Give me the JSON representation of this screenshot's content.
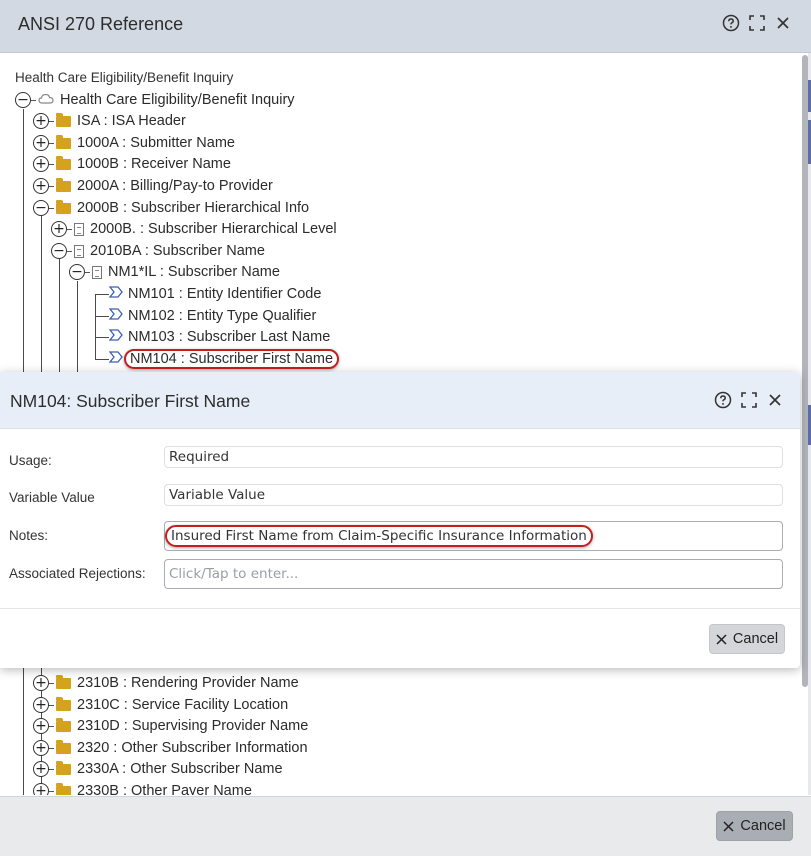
{
  "window": {
    "title": "ANSI 270 Reference",
    "help_icon": "help-circle-icon",
    "maximize_icon": "maximize-icon",
    "close_icon": "close-icon"
  },
  "tree": {
    "caption": "Health Care Eligibility/Benefit Inquiry",
    "nodes": [
      {
        "label": "Health Care Eligibility/Benefit Inquiry",
        "state": "expanded",
        "icon": "cloud-icon"
      },
      {
        "label": "ISA : ISA Header",
        "state": "collapsed",
        "icon": "folder-icon"
      },
      {
        "label": "1000A : Submitter Name",
        "state": "collapsed",
        "icon": "folder-icon"
      },
      {
        "label": "1000B : Receiver Name",
        "state": "collapsed",
        "icon": "folder-icon"
      },
      {
        "label": "2000A : Billing/Pay-to Provider",
        "state": "collapsed",
        "icon": "folder-icon"
      },
      {
        "label": "2000B : Subscriber Hierarchical Info",
        "state": "expanded",
        "icon": "folder-icon"
      },
      {
        "label": "2000B. : Subscriber Hierarchical Level",
        "state": "collapsed",
        "icon": "document-icon"
      },
      {
        "label": "2010BA : Subscriber Name",
        "state": "expanded",
        "icon": "document-icon"
      },
      {
        "label": "NM1*IL : Subscriber Name",
        "state": "expanded",
        "icon": "document-icon"
      },
      {
        "label": "NM101 : Entity Identifier Code",
        "icon": "element-icon"
      },
      {
        "label": "NM102 : Entity Type Qualifier",
        "icon": "element-icon"
      },
      {
        "label": "NM103 : Subscriber Last Name",
        "icon": "element-icon"
      },
      {
        "label": "NM104 : Subscriber First Name",
        "icon": "element-icon",
        "selected": true
      },
      {
        "label": "2310B : Rendering Provider Name",
        "state": "collapsed",
        "icon": "folder-icon"
      },
      {
        "label": "2310C : Service Facility Location",
        "state": "collapsed",
        "icon": "folder-icon"
      },
      {
        "label": "2310D : Supervising Provider Name",
        "state": "collapsed",
        "icon": "folder-icon"
      },
      {
        "label": "2320 : Other Subscriber Information",
        "state": "collapsed",
        "icon": "folder-icon"
      },
      {
        "label": "2330A : Other Subscriber Name",
        "state": "collapsed",
        "icon": "folder-icon"
      },
      {
        "label": "2330B : Other Payer Name",
        "state": "collapsed",
        "icon": "folder-icon"
      }
    ]
  },
  "detail": {
    "title": "NM104: Subscriber First Name",
    "fields": [
      {
        "label": "Usage:",
        "value": "Required"
      },
      {
        "label": "Variable Value",
        "value": "Variable Value"
      },
      {
        "label": "Notes:",
        "value": "Insured First Name from Claim-Specific Insurance Information"
      },
      {
        "label": "Associated Rejections:",
        "placeholder": "Click/Tap to enter..."
      }
    ],
    "cancel_label": "Cancel"
  },
  "footer": {
    "cancel_label": "Cancel"
  },
  "colors": {
    "header_bg": "#d3d9e3",
    "inner_header_bg": "#e8eef7",
    "folder": "#d4a21c",
    "highlight": "#c41e1e",
    "element_icon": "#3b5fae"
  }
}
